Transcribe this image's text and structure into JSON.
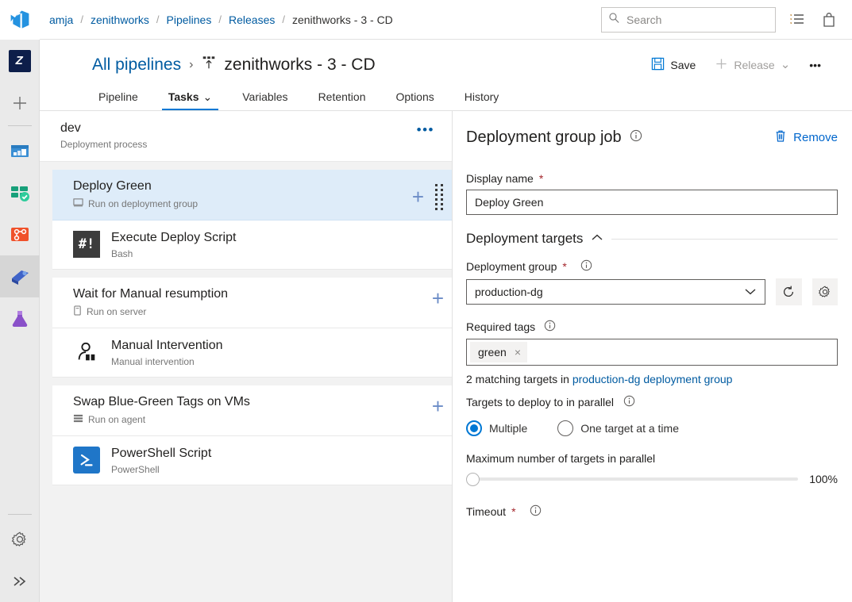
{
  "topbar": {
    "breadcrumbs": [
      {
        "label": "amja",
        "link": true
      },
      {
        "label": "zenithworks",
        "link": true
      },
      {
        "label": "Pipelines",
        "link": true
      },
      {
        "label": "Releases",
        "link": true
      },
      {
        "label": "zenithworks - 3 - CD",
        "link": false
      }
    ],
    "separator": "/",
    "search": {
      "placeholder": "Search",
      "value": "",
      "icon": "search-icon"
    },
    "icons": [
      {
        "name": "backlog-list-icon"
      },
      {
        "name": "shopping-bag-icon"
      }
    ]
  },
  "rail": {
    "logo": "azure-devops-logo",
    "project_initial": "Z",
    "items": [
      {
        "name": "new-item-icon",
        "label": "New"
      },
      {
        "name": "overview-icon",
        "label": "Overview"
      },
      {
        "name": "boards-icon",
        "label": "Boards"
      },
      {
        "name": "repos-icon",
        "label": "Repos"
      },
      {
        "name": "pipelines-icon",
        "label": "Pipelines",
        "selected": true
      },
      {
        "name": "test-plans-icon",
        "label": "Test Plans"
      }
    ],
    "bottom": [
      {
        "name": "settings-gear-icon",
        "label": "Project settings"
      },
      {
        "name": "expand-chevrons-icon",
        "label": "Expand"
      }
    ]
  },
  "page": {
    "all_pipelines": "All pipelines",
    "chevron": "›",
    "title": "zenithworks - 3 - CD",
    "title_icon": "release-pipeline-icon",
    "actions": {
      "save": {
        "label": "Save",
        "icon": "save-floppy-icon",
        "disabled": false
      },
      "release": {
        "label": "Release",
        "icon": "plus-icon",
        "disabled": true,
        "chevron": "⌄"
      },
      "more": {
        "label": "•••",
        "name": "more-actions-icon"
      }
    },
    "tabs": [
      {
        "label": "Pipeline",
        "active": false,
        "chevron": false
      },
      {
        "label": "Tasks",
        "active": true,
        "chevron": true
      },
      {
        "label": "Variables",
        "active": false,
        "chevron": false
      },
      {
        "label": "Retention",
        "active": false,
        "chevron": false
      },
      {
        "label": "Options",
        "active": false,
        "chevron": false
      },
      {
        "label": "History",
        "active": false,
        "chevron": false
      }
    ]
  },
  "tasklist": {
    "process": {
      "name": "dev",
      "subtitle": "Deployment process",
      "menu": "•••"
    },
    "groups": [
      {
        "job": {
          "name": "Deploy Green",
          "subtitle": "Run on deployment group",
          "icon": "deployment-group-icon",
          "selected": true,
          "add": "+",
          "handle": "drag-handle-icon"
        },
        "tasks": [
          {
            "name": "Execute Deploy Script",
            "subtitle": "Bash",
            "icon": "bash-icon",
            "glyph": "#!"
          }
        ]
      },
      {
        "job": {
          "name": "Wait for Manual resumption",
          "subtitle": "Run on server",
          "icon": "server-icon",
          "selected": false,
          "add": "+"
        },
        "tasks": [
          {
            "name": "Manual Intervention",
            "subtitle": "Manual intervention",
            "icon": "manual-intervention-icon"
          }
        ]
      },
      {
        "job": {
          "name": "Swap Blue-Green Tags on VMs",
          "subtitle": "Run on agent",
          "icon": "agent-icon",
          "selected": false,
          "add": "+"
        },
        "tasks": [
          {
            "name": "PowerShell Script",
            "subtitle": "PowerShell",
            "icon": "powershell-icon"
          }
        ]
      }
    ]
  },
  "detail": {
    "title": "Deployment group job",
    "title_info": "info-icon",
    "remove": {
      "label": "Remove",
      "icon": "trash-icon"
    },
    "display_name": {
      "label": "Display name",
      "required": "*",
      "value": "Deploy Green"
    },
    "section": {
      "label": "Deployment targets",
      "collapse_icon": "chevron-up-icon"
    },
    "deployment_group": {
      "label": "Deployment group",
      "required": "*",
      "info": "info-icon",
      "value": "production-dg",
      "chevron": "⌄",
      "refresh_icon": "refresh-icon",
      "manage_icon": "gear-icon"
    },
    "required_tags": {
      "label": "Required tags",
      "info": "info-icon",
      "tags": [
        {
          "label": "green",
          "remove": "×"
        }
      ]
    },
    "matching": {
      "prefix": "2 matching targets in ",
      "link": "production-dg deployment group"
    },
    "parallel": {
      "label": "Targets to deploy to in parallel",
      "info": "info-icon",
      "options": [
        {
          "label": "Multiple",
          "selected": true
        },
        {
          "label": "One target at a time",
          "selected": false
        }
      ]
    },
    "max_parallel": {
      "label": "Maximum number of targets in parallel",
      "value": "100%",
      "percent": 0
    },
    "timeout": {
      "label": "Timeout",
      "required": "*",
      "info": "info-icon"
    }
  },
  "colors": {
    "accent": "#0078d4",
    "link": "#005ba1",
    "selected_row": "#deecf9",
    "required": "#a4262c"
  }
}
